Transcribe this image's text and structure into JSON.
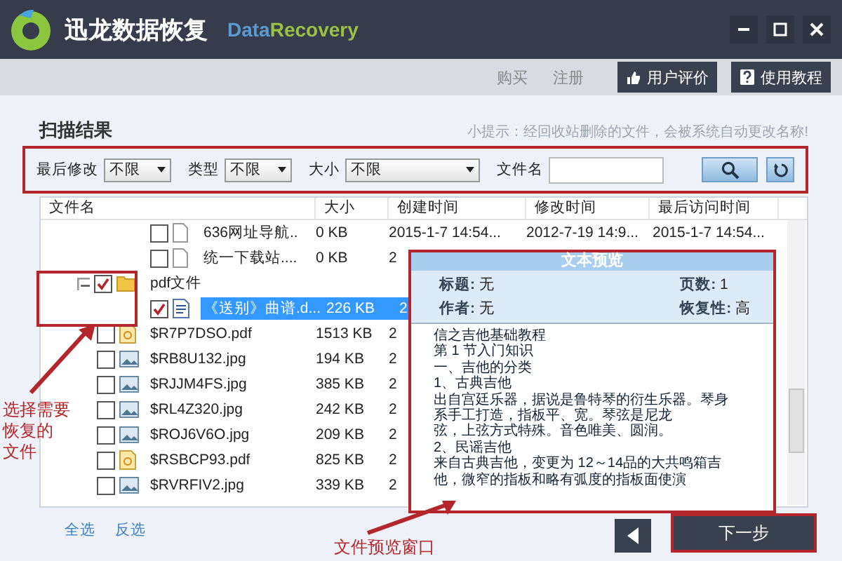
{
  "window": {
    "title": "迅龙数据恢复",
    "brand_first": "Data",
    "brand_second": "Recovery"
  },
  "toolbar": {
    "links": [
      "购买",
      "注册"
    ],
    "buttons": [
      {
        "label": "用户评价",
        "kind": "rate"
      },
      {
        "label": "使用教程",
        "kind": "help"
      }
    ]
  },
  "scan": {
    "title": "扫描结果",
    "hint": "小提示：经回收站删除的文件，会被系统自动更改名称!"
  },
  "filters": [
    {
      "label": "最后修改",
      "value": "不限",
      "kind": "select"
    },
    {
      "label": "类型",
      "value": "不限",
      "kind": "select"
    },
    {
      "label": "大小",
      "value": "不限",
      "kind": "wide-select"
    },
    {
      "label": "文件名",
      "kind": "text"
    }
  ],
  "table": {
    "columns": [
      "文件名",
      "大小",
      "创建时间",
      "修改时间",
      "最后访问时间"
    ],
    "rows": [
      {
        "kind": "continued",
        "children": [
          {
            "kind": "file",
            "name": "636网址导航..",
            "size": "0 KB",
            "created": "2015-1-7 14:54...",
            "modified": "2012-7-19 14:9...",
            "accessed": "2015-1-7 14:54...",
            "checked": false,
            "selected": false
          },
          {
            "kind": "file",
            "name": "统一下载站....",
            "size": "0 KB",
            "created": "2",
            "checked": false,
            "selected": false
          }
        ]
      },
      {
        "kind": "folder",
        "name": "pdf文件",
        "checked": true,
        "selected": false,
        "expanded": true,
        "children": [
          {
            "kind": "word",
            "name": "《送别》曲谱.d...",
            "size": "226 KB",
            "created": "2",
            "checked": true,
            "selected": true
          }
        ]
      },
      {
        "kind": "pdf",
        "name": "$R7P7DSO.pdf",
        "size": "1513 KB",
        "created": "2",
        "checked": false,
        "selected": false
      },
      {
        "kind": "image",
        "name": "$RB8U132.jpg",
        "size": "194 KB",
        "created": "2",
        "checked": false,
        "selected": false
      },
      {
        "kind": "image",
        "name": "$RJJM4FS.jpg",
        "size": "385 KB",
        "created": "2",
        "checked": false,
        "selected": false
      },
      {
        "kind": "image",
        "name": "$RL4Z320.jpg",
        "size": "242 KB",
        "created": "2",
        "checked": false,
        "selected": false
      },
      {
        "kind": "image",
        "name": "$ROJ6V6O.jpg",
        "size": "209 KB",
        "created": "2",
        "checked": false,
        "selected": false
      },
      {
        "kind": "pdf",
        "name": "$RSBCP93.pdf",
        "size": "825 KB",
        "created": "2",
        "checked": false,
        "selected": false
      },
      {
        "kind": "image",
        "name": "$RVRFIV2.jpg",
        "size": "339 KB",
        "created": "2",
        "checked": false,
        "selected": false
      }
    ]
  },
  "footer": {
    "links": [
      "全选",
      "反选"
    ],
    "next": "下一步"
  },
  "preview": {
    "title": "文本预览",
    "fields": [
      {
        "label": "标题:",
        "value": "无"
      },
      {
        "label": "页数:",
        "value": "1"
      },
      {
        "label": "作者:",
        "value": "无"
      },
      {
        "label": "恢复性:",
        "value": "高"
      }
    ],
    "lines": [
      "信之吉他基础教程",
      "第 1 节入门知识",
      "一、吉他的分类",
      "1、古典吉他",
      "出自宫廷乐器，据说是鲁特琴的衍生乐器。琴身",
      "系手工打造，指板平、宽。琴弦是尼龙",
      "弦，上弦方式特殊。音色唯美、圆润。",
      "2、民谣吉他",
      "来自古典吉他，变更为 12～14品的大共鸣箱吉",
      "他，微窄的指板和略有弧度的指板面使演"
    ]
  },
  "annotations": [
    {
      "kind": "files",
      "lines": [
        "选择需要",
        "恢复的",
        "文件"
      ]
    },
    {
      "kind": "preview",
      "lines": [
        "文件预览窗口"
      ]
    }
  ]
}
